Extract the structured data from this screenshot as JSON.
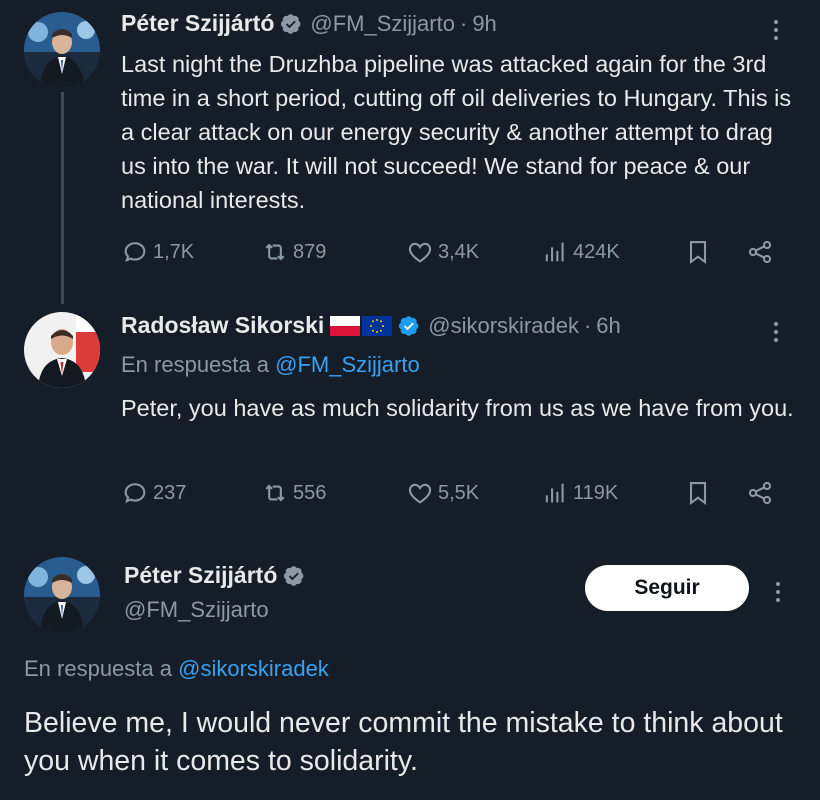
{
  "tweets": [
    {
      "author_name": "Péter Szijjártó",
      "handle": "@FM_Szijjarto",
      "separator": "·",
      "time": "9h",
      "text": "Last night the Druzhba pipeline was attacked again for the 3rd time in a short period, cutting off oil deliveries to Hungary. This is a clear attack on our energy security & another attempt to drag us into the war. It will not succeed! We stand for peace & our national interests.",
      "replies": "1,7K",
      "retweets": "879",
      "likes": "3,4K",
      "views": "424K"
    },
    {
      "author_name": "Radosław Sikorski",
      "handle": "@sikorskiradek",
      "separator": "·",
      "time": "6h",
      "reply_prefix": "En respuesta a",
      "reply_mention": "@FM_Szijjarto",
      "text": "Peter, you have as much solidarity from us as we have from you.",
      "replies": "237",
      "retweets": "556",
      "likes": "5,5K",
      "views": "119K"
    }
  ],
  "main_tweet": {
    "author_name": "Péter Szijjártó",
    "handle": "@FM_Szijjarto",
    "follow_label": "Seguir",
    "reply_prefix": "En respuesta a",
    "reply_mention": "@sikorskiradek",
    "text": "Believe me, I would never commit the mistake to think about you when it comes to solidarity."
  },
  "colors": {
    "background": "#151d28",
    "accent": "#3aa0f0",
    "muted": "#8b98a5",
    "verified": "#1d9bf0"
  }
}
